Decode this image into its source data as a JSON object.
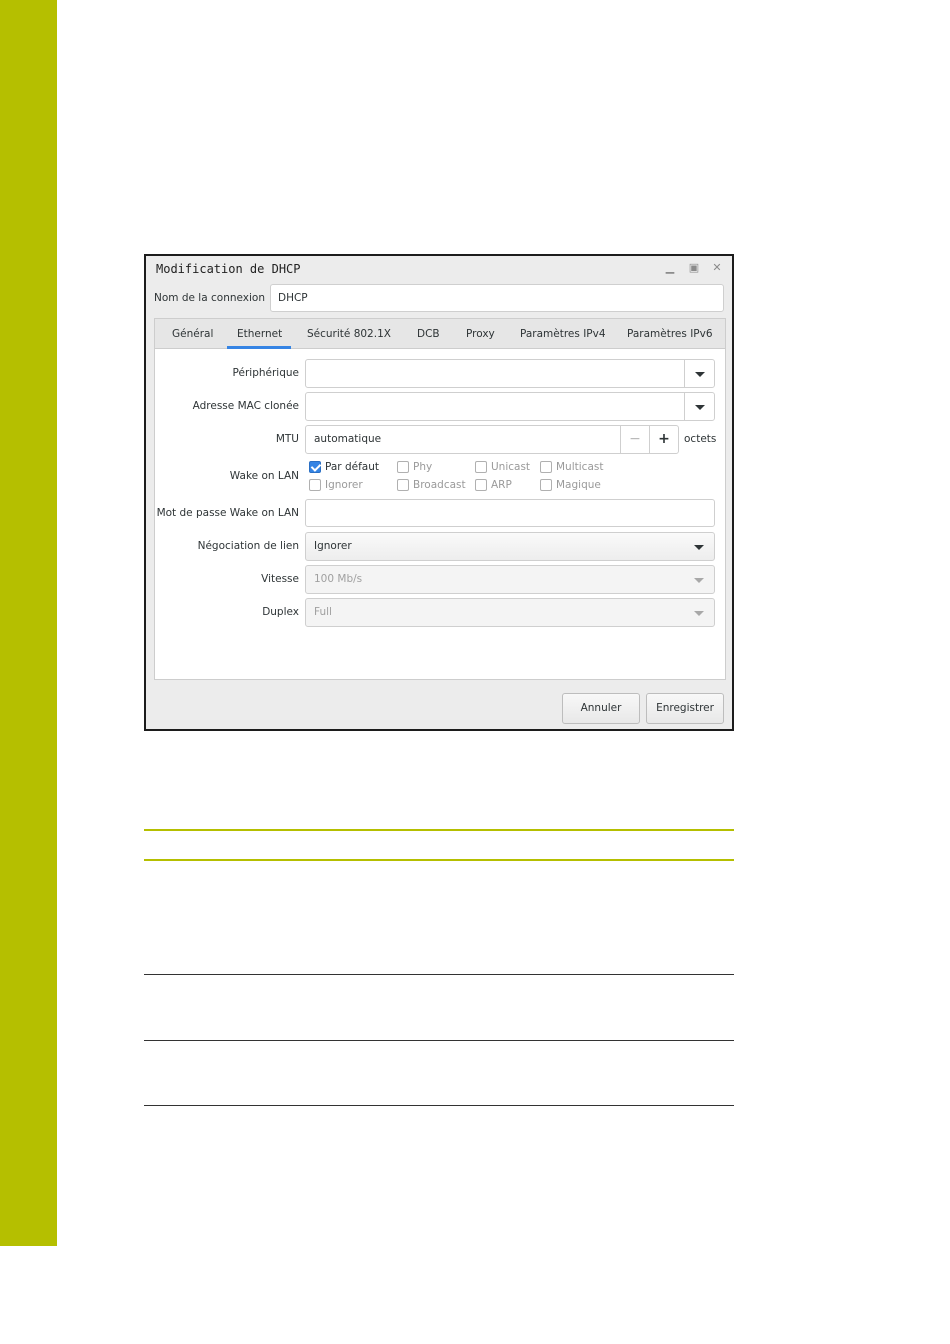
{
  "colors": {
    "accent_sidebar": "#b5bf00",
    "tab_highlight": "#3584e4"
  },
  "dialog": {
    "title": "Modification de DHCP",
    "window_buttons": {
      "minimize": "minimize-icon",
      "maximize": "maximize-icon",
      "close": "close-icon"
    },
    "connection_name_label": "Nom de la connexion",
    "connection_name_value": "DHCP",
    "tabs": [
      {
        "label": "Général"
      },
      {
        "label": "Ethernet",
        "active": true
      },
      {
        "label": "Sécurité 802.1X"
      },
      {
        "label": "DCB"
      },
      {
        "label": "Proxy"
      },
      {
        "label": "Paramètres IPv4"
      },
      {
        "label": "Paramètres IPv6"
      }
    ],
    "ethernet": {
      "device_label": "Périphérique",
      "device_value": "",
      "cloned_mac_label": "Adresse MAC clonée",
      "cloned_mac_value": "",
      "mtu_label": "MTU",
      "mtu_value": "automatique",
      "mtu_unit": "octets",
      "wol_label": "Wake on LAN",
      "wol_options": [
        {
          "label": "Par défaut",
          "checked": true
        },
        {
          "label": "Phy",
          "checked": false
        },
        {
          "label": "Unicast",
          "checked": false
        },
        {
          "label": "Multicast",
          "checked": false
        },
        {
          "label": "Ignorer",
          "checked": false
        },
        {
          "label": "Broadcast",
          "checked": false
        },
        {
          "label": "ARP",
          "checked": false
        },
        {
          "label": "Magique",
          "checked": false
        }
      ],
      "wol_password_label": "Mot de passe Wake on LAN",
      "wol_password_value": "",
      "link_negotiation_label": "Négociation de lien",
      "link_negotiation_value": "Ignorer",
      "speed_label": "Vitesse",
      "speed_value": "100 Mb/s",
      "duplex_label": "Duplex",
      "duplex_value": "Full"
    },
    "buttons": {
      "cancel": "Annuler",
      "save": "Enregistrer"
    }
  }
}
